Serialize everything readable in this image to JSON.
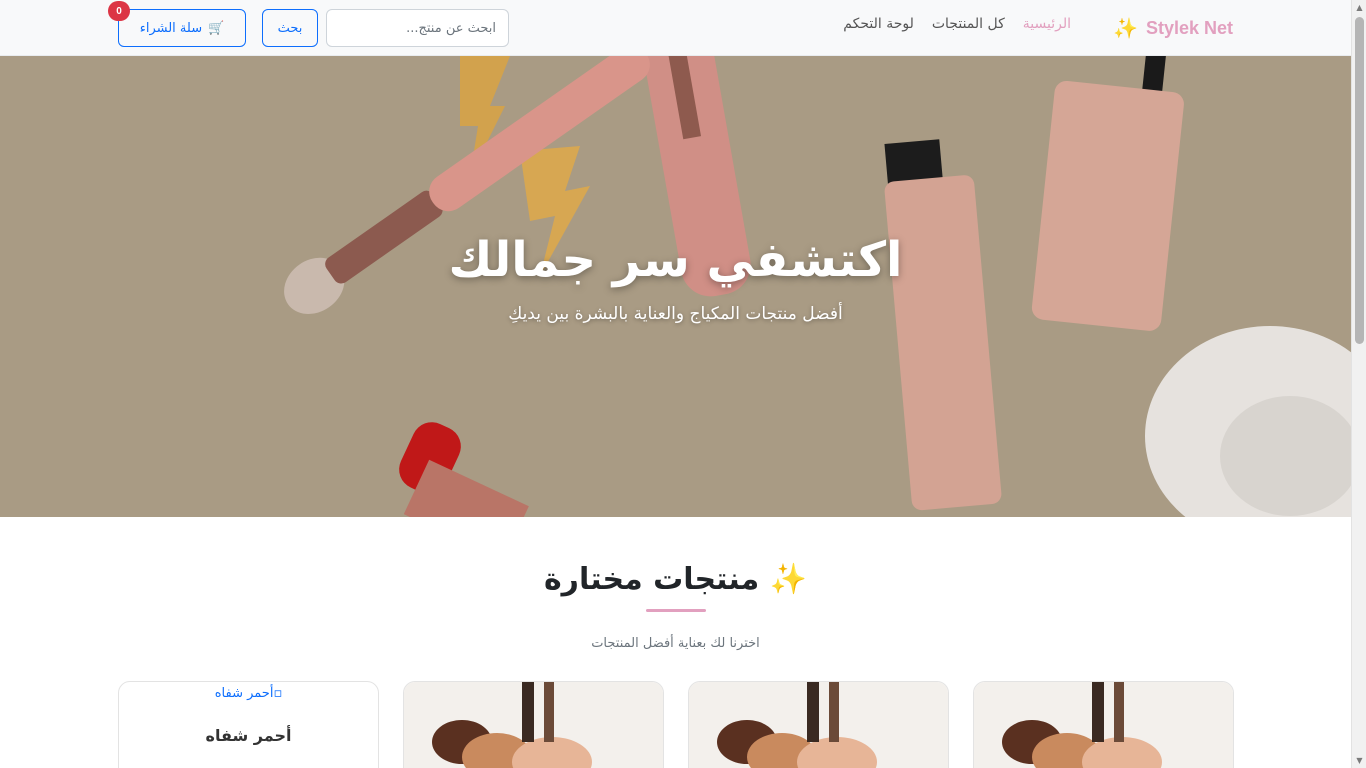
{
  "navbar": {
    "brand": "Stylek Net",
    "brand_icon": "sparkles-icon",
    "links": [
      {
        "label": "الرئيسية",
        "active": true
      },
      {
        "label": "كل المنتجات",
        "active": false
      },
      {
        "label": "لوحة التحكم",
        "active": false
      }
    ],
    "search_placeholder": "ابحث عن منتج...",
    "search_button": "بحث",
    "cart_label": "سلة الشراء",
    "cart_icon": "cart-icon",
    "cart_count": "0"
  },
  "hero": {
    "title": "اكتشفي سر جمالك",
    "subtitle": "أفضل منتجات المكياج والعناية بالبشرة بين يديكِ"
  },
  "featured": {
    "title": "منتجات مختارة",
    "subtitle": "اخترنا لك بعناية أفضل المنتجات"
  },
  "products": [
    {
      "image_alt": "أحمر شفاه",
      "name": "أحمر شفاه"
    }
  ],
  "colors": {
    "brand": "#e2a0bf",
    "primary": "#0d6efd",
    "badge": "#dc3545",
    "hero_bg": "#a99b84"
  }
}
